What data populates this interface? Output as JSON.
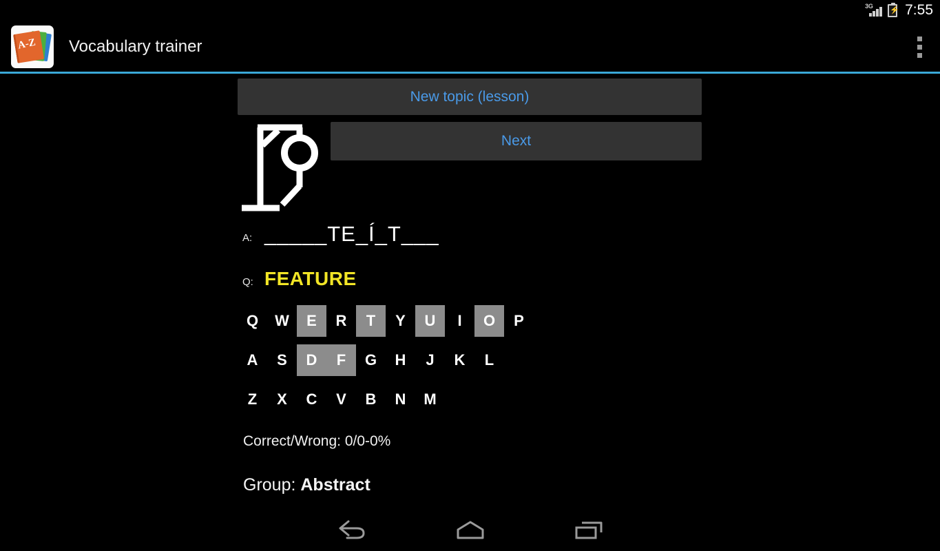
{
  "status_bar": {
    "network_label": "3G",
    "signal_icon": "signal-bars-icon",
    "battery_icon": "battery-charging-icon",
    "time": "7:55"
  },
  "action_bar": {
    "app_icon": "vocabulary-trainer-app-icon",
    "app_icon_text": "A-Z",
    "title": "Vocabulary trainer",
    "overflow_icon": "overflow-menu-icon"
  },
  "colors": {
    "accent": "#3aa8d8",
    "button_text": "#4a9ae8",
    "button_bg": "#333333",
    "question_text": "#f2e526",
    "key_used_bg": "#8c8c8c",
    "background": "#000000"
  },
  "main": {
    "new_topic_button": "New topic (lesson)",
    "next_button": "Next",
    "hangman_icon": "hangman-gallows-icon",
    "answer_label": "A:",
    "answer_text": "_____TE_Í_T___",
    "question_label": "Q:",
    "question_text": "FEATURE",
    "stats_text": "Correct/Wrong: 0/0-0%",
    "group_label": "Group: ",
    "group_value": "Abstract"
  },
  "keyboard": {
    "rows": [
      [
        {
          "letter": "Q",
          "used": false
        },
        {
          "letter": "W",
          "used": false
        },
        {
          "letter": "E",
          "used": true
        },
        {
          "letter": "R",
          "used": false
        },
        {
          "letter": "T",
          "used": true
        },
        {
          "letter": "Y",
          "used": false
        },
        {
          "letter": "U",
          "used": true
        },
        {
          "letter": "I",
          "used": false
        },
        {
          "letter": "O",
          "used": true
        },
        {
          "letter": "P",
          "used": false
        }
      ],
      [
        {
          "letter": "A",
          "used": false
        },
        {
          "letter": "S",
          "used": false
        },
        {
          "letter": "D",
          "used": true
        },
        {
          "letter": "F",
          "used": true
        },
        {
          "letter": "G",
          "used": false
        },
        {
          "letter": "H",
          "used": false
        },
        {
          "letter": "J",
          "used": false
        },
        {
          "letter": "K",
          "used": false
        },
        {
          "letter": "L",
          "used": false
        }
      ],
      [
        {
          "letter": "Z",
          "used": false
        },
        {
          "letter": "X",
          "used": false
        },
        {
          "letter": "C",
          "used": false
        },
        {
          "letter": "V",
          "used": false
        },
        {
          "letter": "B",
          "used": false
        },
        {
          "letter": "N",
          "used": false
        },
        {
          "letter": "M",
          "used": false
        }
      ]
    ]
  },
  "nav_bar": {
    "back_icon": "back-icon",
    "home_icon": "home-icon",
    "recents_icon": "recent-apps-icon"
  }
}
